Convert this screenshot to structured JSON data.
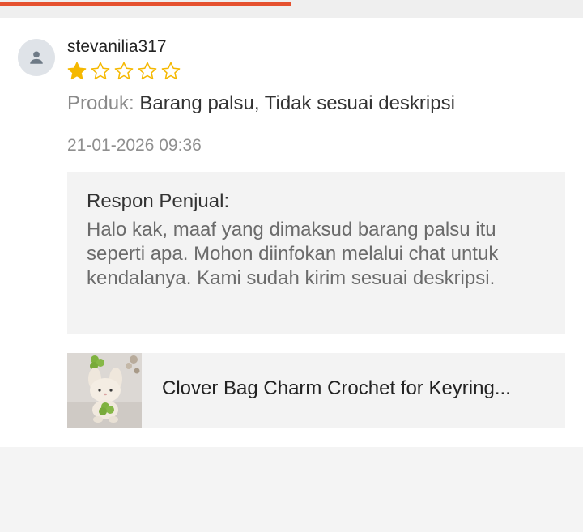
{
  "top_progress": {
    "fraction": 0.5,
    "color": "#e5512f"
  },
  "review": {
    "username": "stevanilia317",
    "rating": 1,
    "max_rating": 5,
    "star_color": "#f5b800",
    "product_label": "Produk:",
    "product_value": "Barang palsu, Tidak sesuai deskripsi",
    "timestamp": "21-01-2026 09:36",
    "avatar_icon": "user-icon"
  },
  "seller_reply": {
    "title": "Respon Penjual:",
    "text": "Halo kak, maaf yang dimaksud barang palsu itu seperti apa. Mohon diinfokan melalui chat untuk kendalanya. Kami sudah kirim sesuai deskripsi."
  },
  "product": {
    "name": "Clover Bag Charm Crochet for Keyring..."
  }
}
